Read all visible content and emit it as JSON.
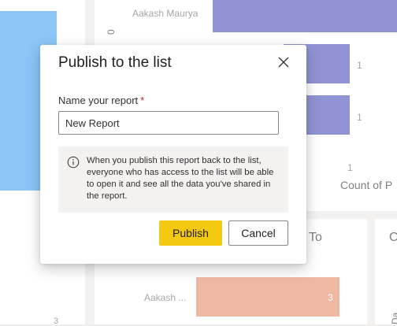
{
  "background": {
    "top_chart": {
      "row_label": "Aakash Maurya",
      "bar_values": [
        "1",
        "1"
      ],
      "axis_tick": "1",
      "axis_title": "Count of P",
      "rotated_label": "0"
    },
    "left_chart": {
      "bottom_tick": "3"
    },
    "lower_chart": {
      "title": "To",
      "row_label": "Aakash ...",
      "bar_value": "3"
    },
    "right_chart": {
      "title": "C",
      "rotated_label": "Da"
    }
  },
  "dialog": {
    "title": "Publish to the list",
    "field_label": "Name your report",
    "required_mark": "*",
    "input_value": "New Report",
    "info_text": "When you publish this report back to the list, everyone who has access to the list will be able to open it and see all the data you've shared in the report.",
    "publish_label": "Publish",
    "cancel_label": "Cancel"
  },
  "colors": {
    "accent_yellow": "#f2c811",
    "bar_purple": "#6b6fc6",
    "bar_blue": "#64b3f4",
    "bar_salmon": "#e8a185"
  },
  "icons": {
    "close": "close-icon",
    "info": "info-icon"
  }
}
